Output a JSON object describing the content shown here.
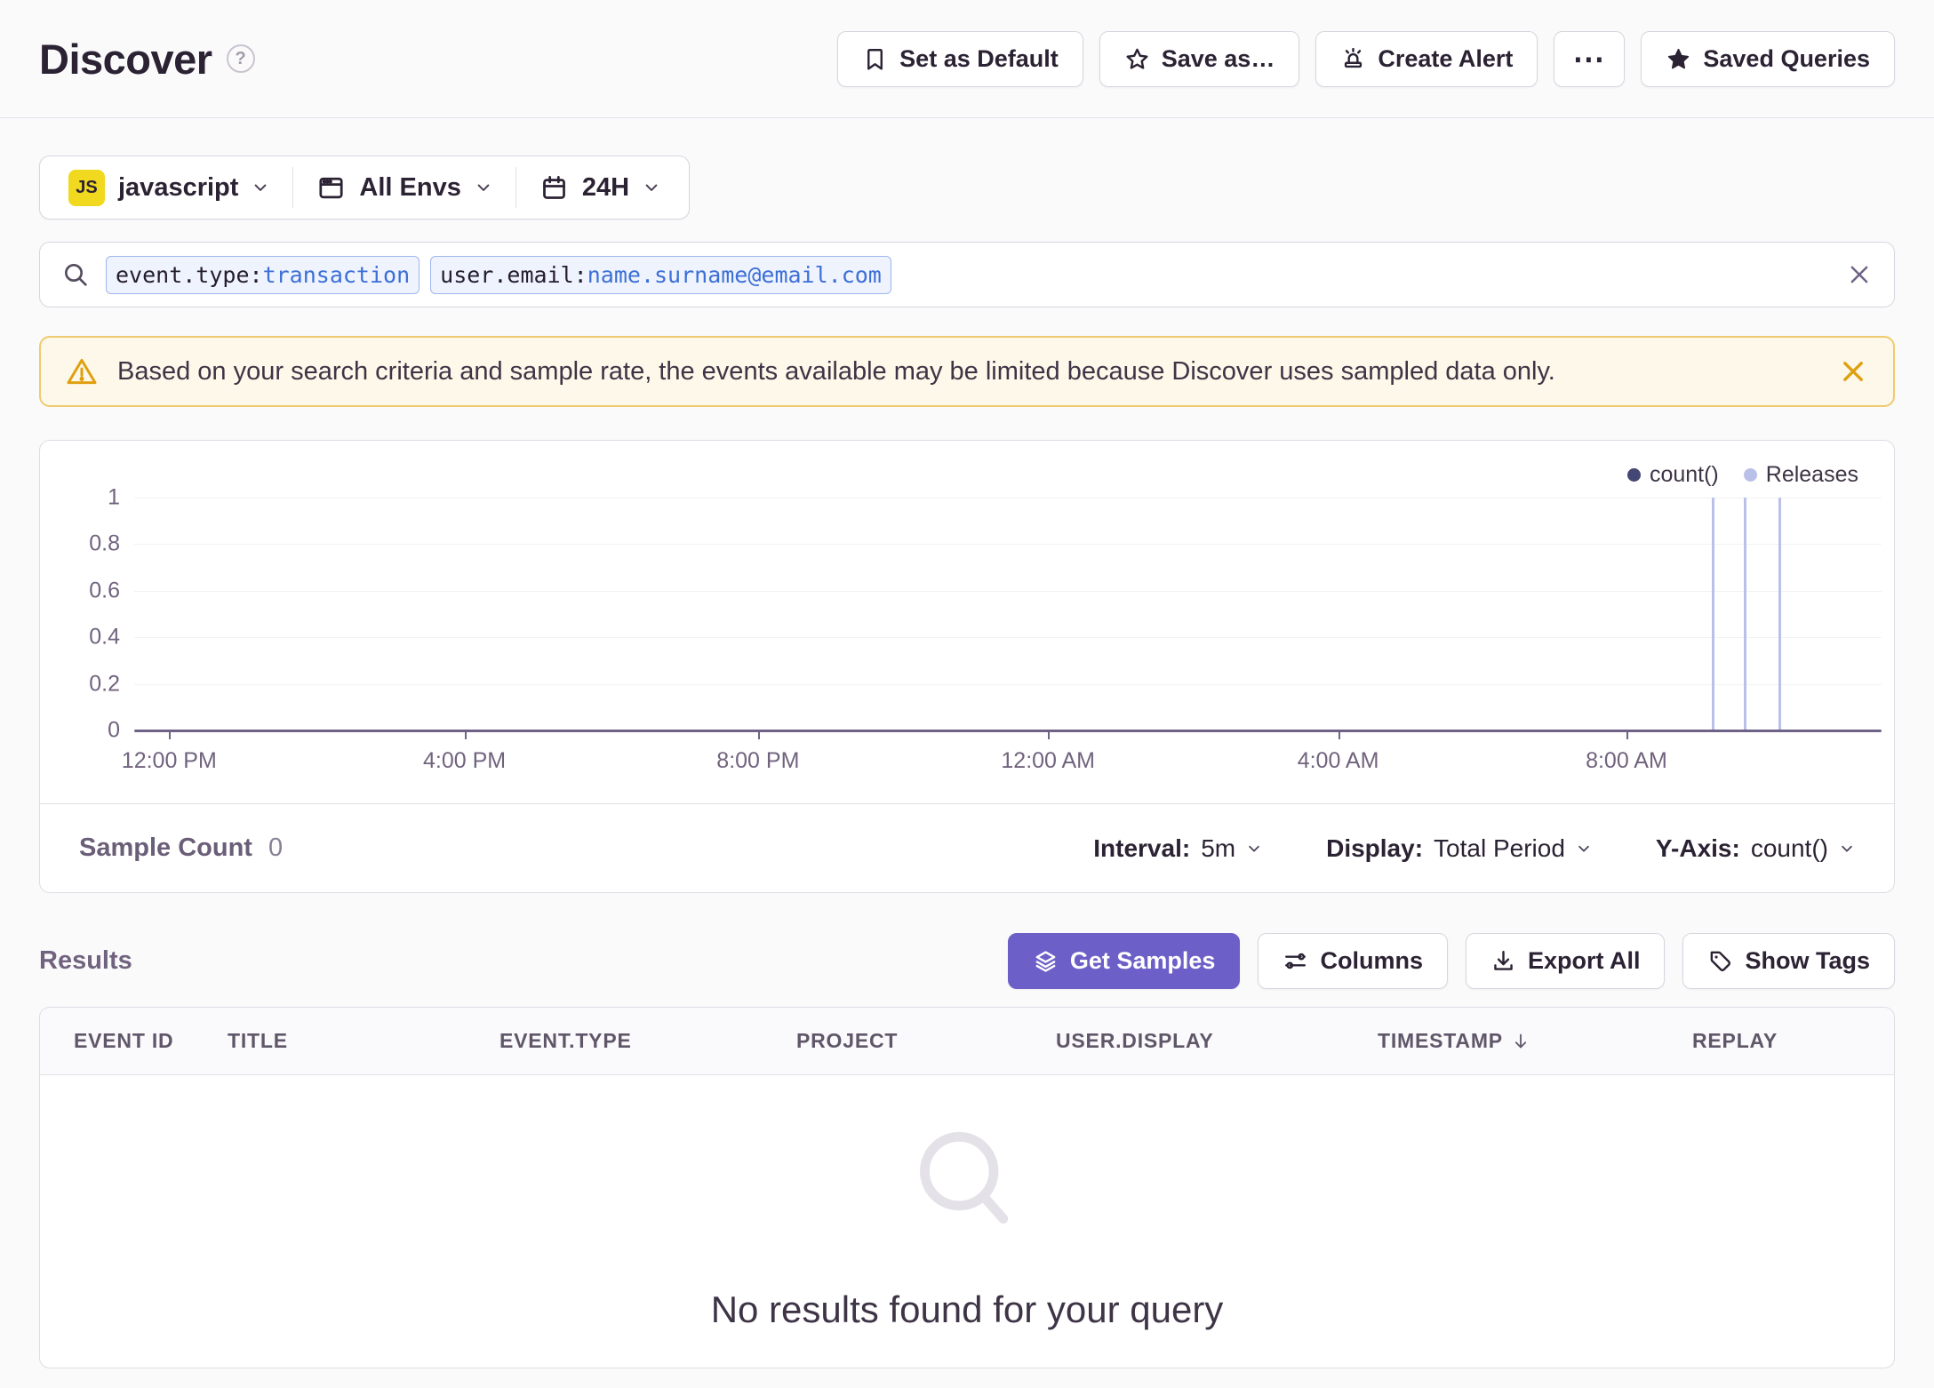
{
  "header": {
    "title": "Discover",
    "help_glyph": "?",
    "actions": [
      {
        "label": "Set as Default",
        "icon": "bookmark-icon"
      },
      {
        "label": "Save as…",
        "icon": "star-outline-icon"
      },
      {
        "label": "Create Alert",
        "icon": "siren-icon"
      },
      {
        "label": "⋯",
        "icon": "ellipsis-icon"
      },
      {
        "label": "Saved Queries",
        "icon": "star-filled-icon"
      }
    ]
  },
  "filters": {
    "project": {
      "badge": "JS",
      "label": "javascript",
      "icon": "javascript-badge"
    },
    "environment": {
      "label": "All Envs",
      "icon": "window-icon"
    },
    "time": {
      "label": "24H",
      "icon": "calendar-icon"
    }
  },
  "search": {
    "tokens": [
      {
        "key": "event.type:",
        "value": "transaction"
      },
      {
        "key": "user.email:",
        "value": "name.surname@email.com"
      }
    ]
  },
  "banner": {
    "text": "Based on your search criteria and sample rate, the events available may be limited because Discover uses sampled data only."
  },
  "chart_data": {
    "type": "line",
    "title": "",
    "xlabel": "",
    "ylabel": "",
    "ylim": [
      0,
      1
    ],
    "y_ticks": [
      0,
      0.2,
      0.4,
      0.6,
      0.8,
      1
    ],
    "y_tick_labels": [
      "1",
      "0.8",
      "0.6",
      "0.4",
      "0.2",
      "0"
    ],
    "x_ticks": [
      "12:00 PM",
      "4:00 PM",
      "8:00 PM",
      "12:00 AM",
      "4:00 AM",
      "8:00 AM"
    ],
    "x_range_hours": 24,
    "grid": true,
    "legend_position": "top-right",
    "legend": [
      "count()",
      "Releases"
    ],
    "series": [
      {
        "name": "count()",
        "color": "#444674",
        "values": []
      }
    ],
    "release_markers": {
      "name": "Releases",
      "color": "#B9C1E8",
      "positions_fraction": [
        0.903,
        0.921,
        0.941
      ]
    }
  },
  "chart_footer": {
    "sample_count_label": "Sample Count",
    "sample_count_value": "0",
    "interval_label": "Interval:",
    "interval_value": "5m",
    "display_label": "Display:",
    "display_value": "Total Period",
    "yaxis_label": "Y-Axis:",
    "yaxis_value": "count()"
  },
  "results": {
    "heading": "Results",
    "actions": [
      {
        "label": "Get Samples",
        "icon": "stack-icon",
        "style": "primary"
      },
      {
        "label": "Columns",
        "icon": "sliders-icon"
      },
      {
        "label": "Export All",
        "icon": "download-icon"
      },
      {
        "label": "Show Tags",
        "icon": "tag-icon"
      }
    ],
    "table": {
      "columns": [
        "EVENT ID",
        "TITLE",
        "EVENT.TYPE",
        "PROJECT",
        "USER.DISPLAY",
        "TIMESTAMP",
        "REPLAY"
      ],
      "sorted_column": "TIMESTAMP",
      "sort_direction": "desc",
      "empty_text": "No results found for your query"
    }
  },
  "colors": {
    "accent_purple": "#6C5FC7",
    "count_series": "#444674",
    "releases": "#B9C1E8",
    "warning_bg": "#FDF8E9",
    "warning_border": "#EFCB6E",
    "warning_icon": "#DFA010",
    "js_badge": "#F0D91E",
    "token_bg": "#EEF3FE",
    "token_border": "#9EB7EC",
    "token_value_text": "#3C6FD6"
  }
}
